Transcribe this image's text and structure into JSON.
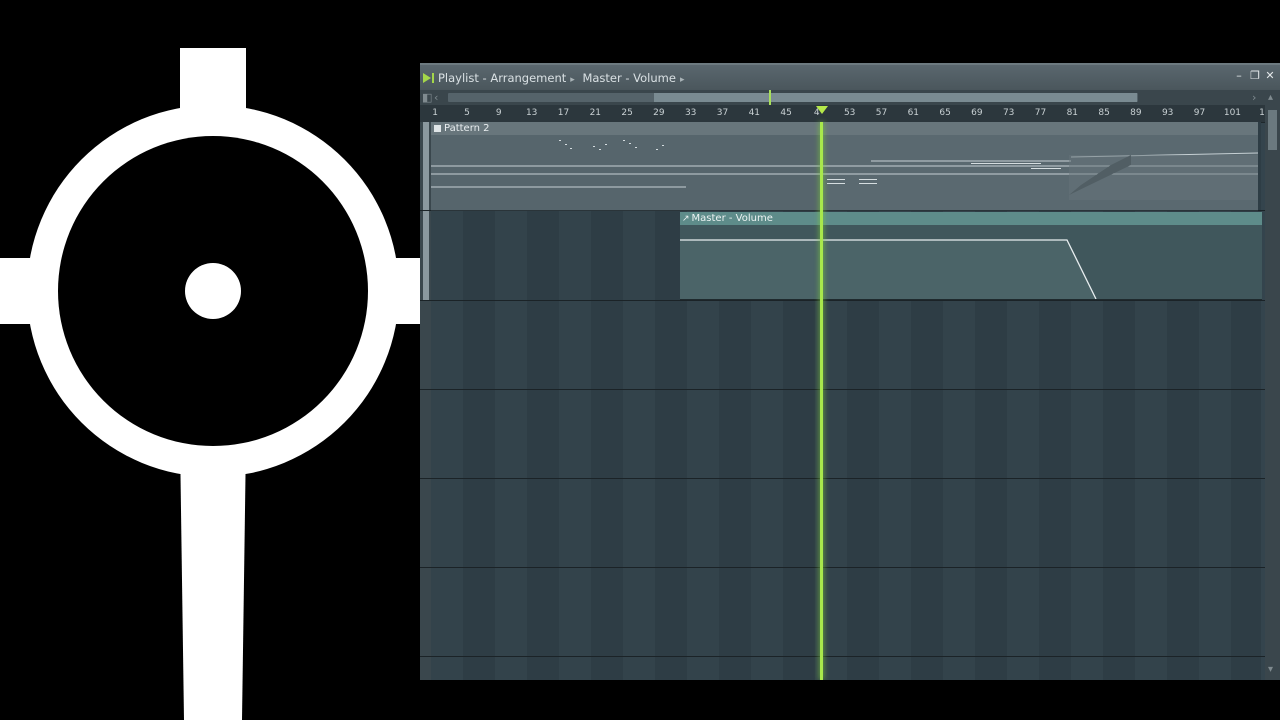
{
  "logo": {
    "name": "crosshair-logo"
  },
  "window": {
    "crumbs": [
      "Playlist - Arrangement",
      "Master - Volume"
    ],
    "minimize": "–",
    "restore": "❐",
    "close": "✕"
  },
  "ruler": {
    "bars": [
      "1",
      "5",
      "9",
      "13",
      "17",
      "21",
      "25",
      "29",
      "33",
      "37",
      "41",
      "45",
      "4",
      "53",
      "57",
      "61",
      "65",
      "69",
      "73",
      "77",
      "81",
      "85",
      "89",
      "93",
      "97",
      "101",
      "1"
    ],
    "playhead_bar": 49
  },
  "tracks": {
    "pattern_clip_label": "Pattern 2",
    "automation_clip_label": "Master - Volume"
  },
  "colors": {
    "playhead": "#a8e84c",
    "automation_header": "#5e8c8a",
    "pattern_header": "#68767c"
  }
}
